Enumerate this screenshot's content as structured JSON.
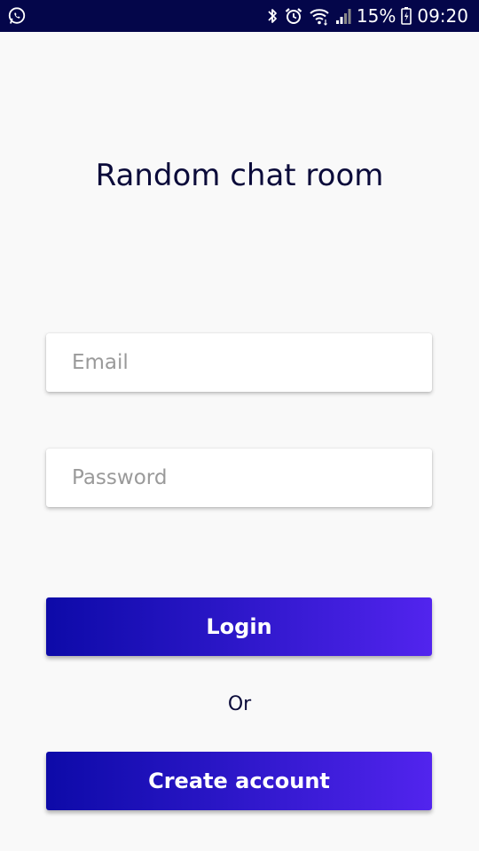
{
  "status_bar": {
    "left_icons": [
      "whatsapp-icon"
    ],
    "right_icons": [
      "bluetooth-icon",
      "alarm-icon",
      "wifi-icon",
      "signal-icon",
      "battery-icon"
    ],
    "battery_percent": "15%",
    "time": "09:20",
    "background_color": "#04064a"
  },
  "main": {
    "title": "Random chat room",
    "email": {
      "placeholder": "Email",
      "value": ""
    },
    "password": {
      "placeholder": "Password",
      "value": ""
    },
    "login_label": "Login",
    "or_label": "Or",
    "create_account_label": "Create account"
  },
  "colors": {
    "button_gradient_start": "#0d0aa8",
    "button_gradient_end": "#5224ee",
    "title_color": "#0b0b3a",
    "background": "#f9f9f9"
  }
}
